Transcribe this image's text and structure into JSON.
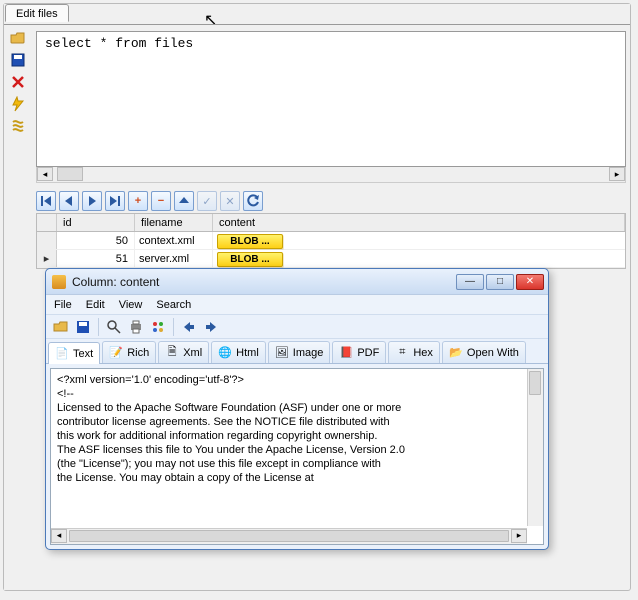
{
  "tab_label": "Edit files",
  "sql_text": "select * from files",
  "grid": {
    "headers": {
      "id": "id",
      "filename": "filename",
      "content": "content"
    },
    "rows": [
      {
        "id": "50",
        "filename": "context.xml",
        "content": "BLOB ..."
      },
      {
        "id": "51",
        "filename": "server.xml",
        "content": "BLOB ..."
      }
    ]
  },
  "dialog": {
    "title": "Column: content",
    "menus": [
      "File",
      "Edit",
      "View",
      "Search"
    ],
    "tabs": [
      "Text",
      "Rich",
      "Xml",
      "Html",
      "Image",
      "PDF",
      "Hex",
      "Open With"
    ],
    "content_lines": [
      "<?xml version='1.0' encoding='utf-8'?>",
      "<!--",
      "  Licensed to the Apache Software Foundation (ASF) under one or more",
      "  contributor license agreements.  See the NOTICE file distributed with",
      "  this work for additional information regarding copyright ownership.",
      "  The ASF licenses this file to You under the Apache License, Version 2.0",
      "  (the \"License\"); you may not use this file except in compliance with",
      "  the License.  You may obtain a copy of the License at"
    ]
  }
}
